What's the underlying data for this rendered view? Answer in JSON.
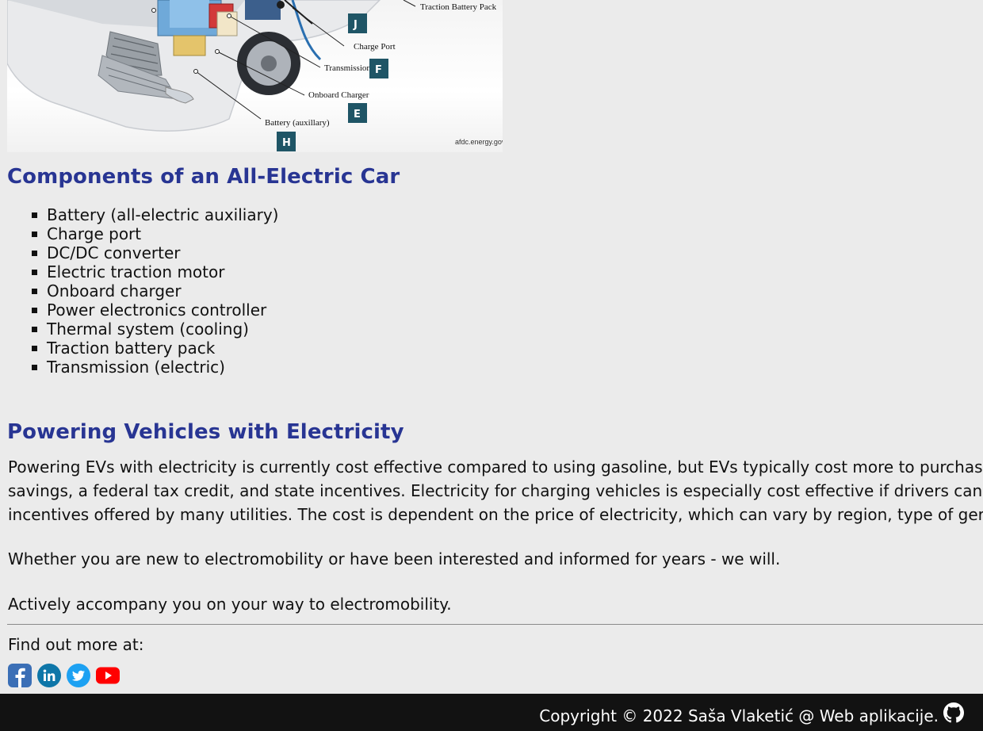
{
  "diagram": {
    "labels": {
      "traction_battery_pack": "Traction Battery Pack",
      "charge_port": "Charge Port",
      "transmission": "Transmission",
      "onboard_charger": "Onboard Charger",
      "battery_aux": "Battery (auxillary)"
    },
    "tags": {
      "j": "J",
      "f": "F",
      "e": "E",
      "h": "H"
    },
    "credit": "afdc.energy.gov"
  },
  "components": {
    "heading": "Components of an All-Electric Car",
    "items": [
      "Battery (all-electric auxiliary)",
      "Charge port",
      "DC/DC converter",
      "Electric traction motor",
      "Onboard charger",
      "Power electronics controller",
      "Thermal system (cooling)",
      "Traction battery pack",
      "Transmission (electric)"
    ]
  },
  "powering": {
    "heading": "Powering Vehicles with Electricity",
    "paragraph_lines": [
      "Powering EVs with electricity is currently cost effective compared to using gasoline, but EVs typically cost more to purchas",
      "savings, a federal tax credit, and state incentives. Electricity for charging vehicles is especially cost effective if drivers can",
      "incentives offered by many utilities. The cost is dependent on the price of electricity, which can vary by region, type of ger"
    ],
    "whether": "Whether you are new to electromobility or have been interested and informed for years - we will.",
    "actively": "Actively accompany you on your way to electromobility."
  },
  "social": {
    "label": "Find out more at:",
    "icons": [
      "facebook-icon",
      "linkedin-icon",
      "twitter-icon",
      "youtube-icon"
    ],
    "colors": {
      "facebook": "#3b5998",
      "linkedin": "#0e76a8",
      "twitter": "#1da1f2",
      "youtube": "#ff0000"
    }
  },
  "footer": {
    "copyright": "Copyright © 2022 Saša Vlaketić @ Web aplikacije.",
    "icon": "github-icon"
  },
  "colors": {
    "heading": "#283593",
    "background": "#ebebeb",
    "footer_bg": "#121212",
    "tag_bg": "#1f5566"
  }
}
